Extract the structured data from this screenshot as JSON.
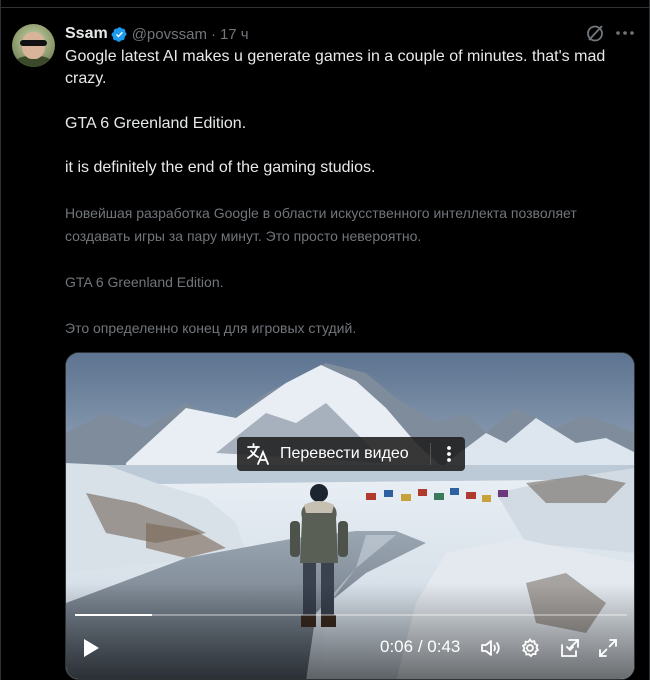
{
  "author": {
    "name": "Ssam",
    "handle": "@povssam",
    "separator": "·",
    "time": "17 ч"
  },
  "post": {
    "line1": "Google latest AI makes u generate games in a couple of minutes. that's mad crazy.",
    "line2": "GTA 6 Greenland Edition.",
    "line3": "it is definitely the end of the gaming studios."
  },
  "translation": {
    "line1": "Новейшая разработка Google в области искусственного интеллекта позволяет создавать игры за пару минут. Это просто невероятно.",
    "line2": "GTA 6 Greenland Edition.",
    "line3": "Это определенно конец для игровых студий."
  },
  "video": {
    "translate_label": "Перевести видео",
    "current_time": "0:06",
    "time_separator": " / ",
    "duration": "0:43",
    "progress_fraction": 0.14
  },
  "icons": {
    "verified": "verified-badge-icon",
    "grok": "grok-icon",
    "more": "more-horizontal-icon",
    "translate": "translate-icon",
    "play": "play-icon",
    "volume": "volume-icon",
    "settings": "gear-icon",
    "pip": "picture-in-picture-icon",
    "fullscreen": "fullscreen-icon"
  },
  "colors": {
    "background": "#000000",
    "text": "#e7e9ea",
    "muted": "#71767b",
    "verified": "#1d9bf0"
  }
}
